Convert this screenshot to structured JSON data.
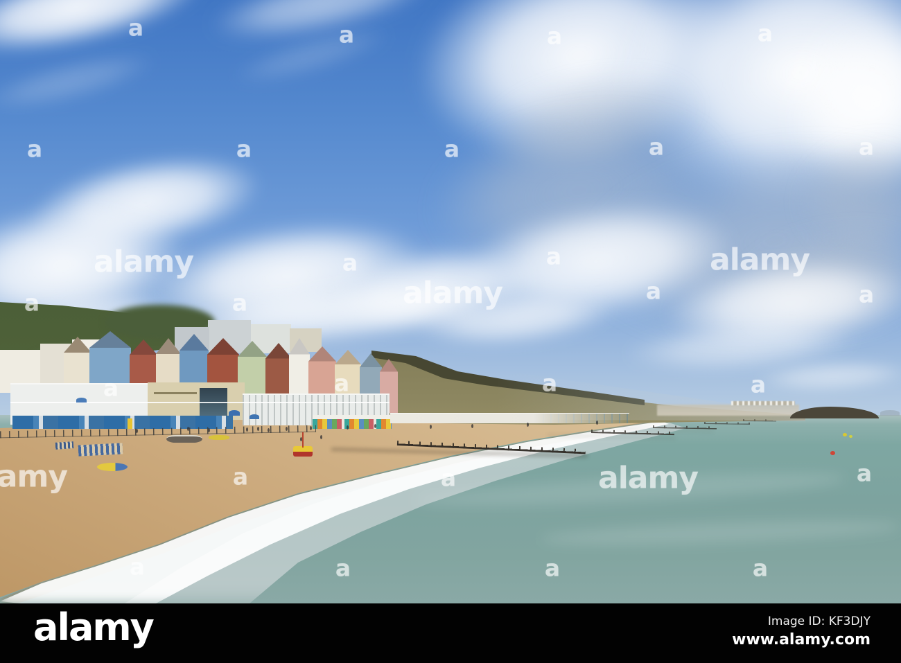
{
  "watermark": {
    "letter": "a",
    "word": "alamy"
  },
  "footer": {
    "logo": "alamy",
    "image_id": "Image ID: KF3DJY",
    "website": "www.alamy.com"
  },
  "scene": {
    "colors": {
      "sky_top": "#4076c4",
      "sky_horizon": "#cdd9e6",
      "sea": "#7da39f",
      "sand": "#d9bf97",
      "cliff": "#79744f",
      "footer_bar": "#020202",
      "watermark": "rgba(255,255,255,0.55)"
    }
  }
}
